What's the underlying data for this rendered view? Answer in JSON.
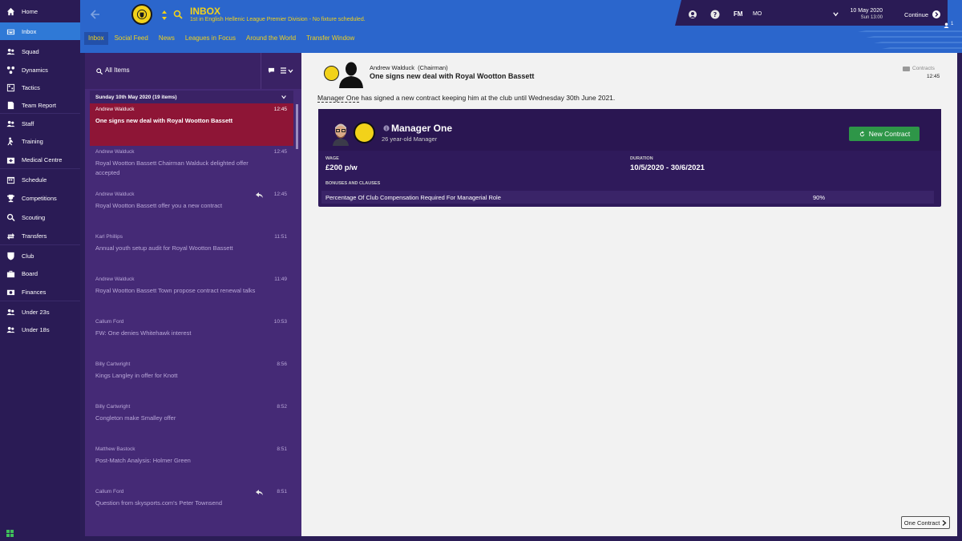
{
  "sidebar": {
    "items": [
      {
        "label": "Home",
        "icon": "home-icon"
      },
      {
        "label": "Inbox",
        "icon": "inbox-icon",
        "active": true
      },
      {
        "label": "Squad",
        "icon": "squad-icon"
      },
      {
        "label": "Dynamics",
        "icon": "dynamics-icon"
      },
      {
        "label": "Tactics",
        "icon": "tactics-icon"
      },
      {
        "label": "Team Report",
        "icon": "team-report-icon"
      },
      {
        "label": "Staff",
        "icon": "staff-icon"
      },
      {
        "label": "Training",
        "icon": "training-icon"
      },
      {
        "label": "Medical Centre",
        "icon": "medical-icon"
      },
      {
        "label": "Schedule",
        "icon": "schedule-icon"
      },
      {
        "label": "Competitions",
        "icon": "trophy-icon"
      },
      {
        "label": "Scouting",
        "icon": "scouting-icon"
      },
      {
        "label": "Transfers",
        "icon": "transfers-icon"
      },
      {
        "label": "Club",
        "icon": "club-icon"
      },
      {
        "label": "Board",
        "icon": "board-icon"
      },
      {
        "label": "Finances",
        "icon": "finances-icon"
      },
      {
        "label": "Under 23s",
        "icon": "under23-icon"
      },
      {
        "label": "Under 18s",
        "icon": "under18-icon"
      }
    ]
  },
  "header": {
    "title": "INBOX",
    "subtitle": "1st in English Hellenic League Premier Division - No fixture scheduled.",
    "tabs": [
      "Inbox",
      "Social Feed",
      "News",
      "Leagues in Focus",
      "Around the World",
      "Transfer Window"
    ],
    "active_tab": 0
  },
  "status": {
    "fm_label": "FM",
    "manager_initials": "MO",
    "date": "10 May 2020",
    "day_time": "Sun 13:00",
    "continue_label": "Continue",
    "user_count": "1"
  },
  "inbox": {
    "filter_label": "All Items",
    "day_header": "Sunday 10th May 2020 (19 items)",
    "messages": [
      {
        "from": "Andrew Walduck",
        "time": "12:45",
        "subject": "One signs new deal with Royal Wootton Bassett",
        "selected": true,
        "replied": false
      },
      {
        "from": "Andrew Walduck",
        "time": "12:45",
        "subject": "Royal Wootton Bassett Chairman Walduck delighted offer accepted",
        "selected": false,
        "replied": false
      },
      {
        "from": "Andrew Walduck",
        "time": "12:45",
        "subject": "Royal Wootton Bassett offer you a new contract",
        "selected": false,
        "replied": true
      },
      {
        "from": "Karl Phillips",
        "time": "11:51",
        "subject": "Annual youth setup audit for Royal Wootton Bassett",
        "selected": false,
        "replied": false
      },
      {
        "from": "Andrew Walduck",
        "time": "11:49",
        "subject": "Royal Wootton Bassett Town propose contract renewal talks",
        "selected": false,
        "replied": false
      },
      {
        "from": "Callum Ford",
        "time": "10:53",
        "subject": "FW: One denies Whitehawk interest",
        "selected": false,
        "replied": false
      },
      {
        "from": "Billy Cartwright",
        "time": "8:56",
        "subject": "Kings Langley in offer for Knott",
        "selected": false,
        "replied": false
      },
      {
        "from": "Billy Cartwright",
        "time": "8:52",
        "subject": "Congleton make Smalley offer",
        "selected": false,
        "replied": false
      },
      {
        "from": "Matthew Bastock",
        "time": "8:51",
        "subject": "Post-Match Analysis: Holmer Green",
        "selected": false,
        "replied": false
      },
      {
        "from": "Callum Ford",
        "time": "8:51",
        "subject": "Question from skysports.com's Peter Townsend",
        "selected": false,
        "replied": true
      }
    ]
  },
  "detail": {
    "from_name": "Andrew Walduck",
    "from_role": "(Chairman)",
    "subject": "One signs new deal with Royal Wootton Bassett",
    "category": "Contracts",
    "time": "12:45",
    "body_name": "Manager One",
    "body_rest": " has signed a new contract keeping him at the club until Wednesday 30th June 2021.",
    "card": {
      "name": "Manager One",
      "description": "26 year-old Manager",
      "button": "New Contract",
      "wage_label": "WAGE",
      "wage": "£200 p/w",
      "duration_label": "DURATION",
      "duration": "10/5/2020 - 30/6/2021",
      "bonuses_label": "BONUSES AND CLAUSES",
      "bonus_name": "Percentage Of Club Compensation Required For Managerial Role",
      "bonus_value": "90%"
    },
    "footer_button": "One Contract"
  },
  "colors": {
    "sidebar_bg": "#2a1b55",
    "header_blue": "#2b66cc",
    "accent_yellow": "#f2d21a",
    "selected_message": "#8e1536",
    "green_button": "#2e9648"
  }
}
